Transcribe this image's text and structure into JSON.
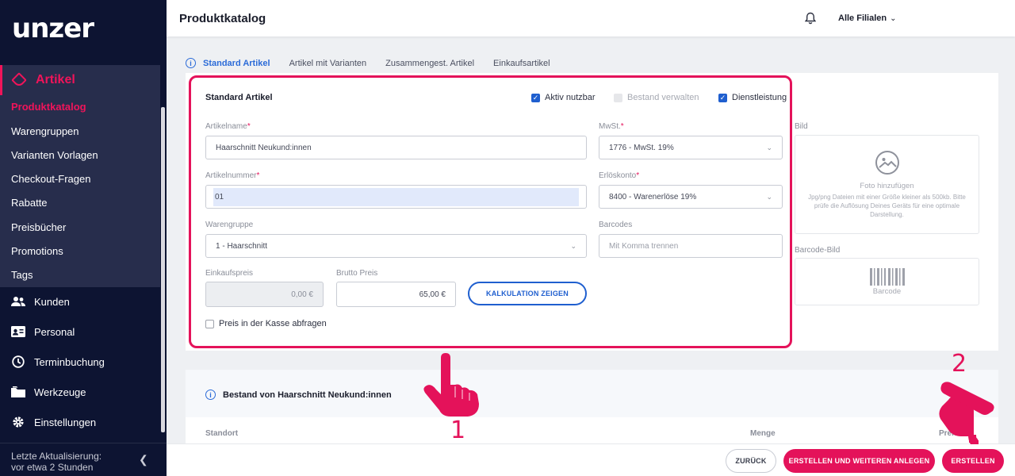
{
  "brand": {
    "logo_text": "unzer",
    "accent": "#e4125a"
  },
  "sidebar": {
    "section": {
      "label": "Artikel",
      "icon": "tag-icon"
    },
    "sub_items": [
      {
        "label": "Produktkatalog",
        "active": true
      },
      {
        "label": "Warengruppen"
      },
      {
        "label": "Varianten Vorlagen"
      },
      {
        "label": "Checkout-Fragen"
      },
      {
        "label": "Rabatte"
      },
      {
        "label": "Preisbücher"
      },
      {
        "label": "Promotions"
      },
      {
        "label": "Tags"
      }
    ],
    "main_items": [
      {
        "label": "Kunden",
        "icon": "users-icon"
      },
      {
        "label": "Personal",
        "icon": "id-card-icon"
      },
      {
        "label": "Terminbuchung",
        "icon": "clock-icon"
      },
      {
        "label": "Werkzeuge",
        "icon": "folder-icon"
      },
      {
        "label": "Einstellungen",
        "icon": "gear-icon"
      }
    ],
    "footer": {
      "line1": "Letzte Aktualisierung:",
      "line2": "vor etwa 2 Stunden"
    }
  },
  "header": {
    "title": "Produktkatalog",
    "branch_label": "Alle Filialen"
  },
  "tabs": [
    "Standard Artikel",
    "Artikel mit Varianten",
    "Zusammengest. Artikel",
    "Einkaufsartikel"
  ],
  "form": {
    "section_title": "Standard Artikel",
    "toggles": {
      "aktiv": "Aktiv nutzbar",
      "bestand": "Bestand verwalten",
      "dienst": "Dienstleistung"
    },
    "artikelname": {
      "label": "Artikelname",
      "value": "Haarschnitt Neukund:innen"
    },
    "mwst": {
      "label": "MwSt.",
      "value": "1776 - MwSt. 19%"
    },
    "artikelnummer": {
      "label": "Artikelnummer",
      "value": "01"
    },
    "erloeskonto": {
      "label": "Erlöskonto",
      "value": "8400 - Warenerlöse 19%"
    },
    "warengruppe": {
      "label": "Warengruppe",
      "value": "1 - Haarschnitt"
    },
    "barcodes": {
      "label": "Barcodes",
      "placeholder": "Mit Komma trennen"
    },
    "einkaufspreis": {
      "label": "Einkaufspreis",
      "value": "0,00 €"
    },
    "brutto": {
      "label": "Brutto Preis",
      "value": "65,00 €"
    },
    "kalkulation_button": "KALKULATION ZEIGEN",
    "kasse_checkbox": "Preis in der Kasse abfragen",
    "required_mark": "*"
  },
  "media": {
    "bild_label": "Bild",
    "photo_title": "Foto hinzufügen",
    "photo_hint": "Jpg/png Dateien mit einer Größe kleiner als 500kb. Bitte prüfe die Auflösung Deines Geräts für eine optimale Darstellung.",
    "barcode_label": "Barcode-Bild",
    "barcode_text": "Barcode"
  },
  "stock": {
    "title": "Bestand von Haarschnitt Neukund:innen",
    "columns": [
      "Standort",
      "Menge",
      "Preis"
    ]
  },
  "footer_buttons": {
    "back": "ZURÜCK",
    "create_more": "ERSTELLEN UND WEITEREN ANLEGEN",
    "create": "ERSTELLEN"
  },
  "annotations": {
    "one": "1",
    "two": "2"
  }
}
